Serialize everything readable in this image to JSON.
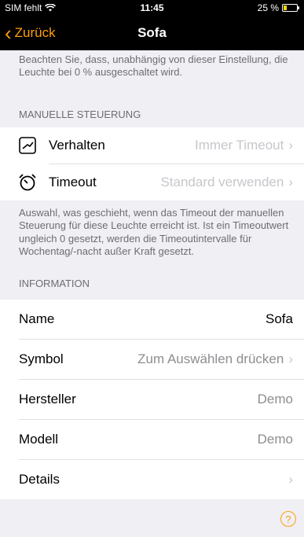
{
  "status": {
    "carrier": "SIM fehlt",
    "time": "11:45",
    "battery": "25 %",
    "battery_level": 0.25
  },
  "nav": {
    "back_label": "Zurück",
    "title": "Sofa"
  },
  "top_note": "Beachten Sie, dass, unabhängig von dieser Einstellung, die Leuchte bei 0 % ausgeschaltet wird.",
  "manual": {
    "header": "MANUELLE STEUERUNG",
    "rows": [
      {
        "label": "Verhalten",
        "value": "Immer Timeout",
        "icon": "behavior-icon"
      },
      {
        "label": "Timeout",
        "value": "Standard verwenden",
        "icon": "timer-icon"
      }
    ],
    "footer": "Auswahl, was geschieht, wenn das Timeout der manuellen Steuerung für diese Leuchte erreicht ist. Ist ein Timeoutwert ungleich 0 gesetzt, werden die Timeoutintervalle für Wochentag/-nacht außer Kraft gesetzt."
  },
  "info": {
    "header": "INFORMATION",
    "rows": [
      {
        "label": "Name",
        "value": "Sofa"
      },
      {
        "label": "Symbol",
        "value": "Zum Auswählen drücken"
      },
      {
        "label": "Hersteller",
        "value": "Demo"
      },
      {
        "label": "Modell",
        "value": "Demo"
      },
      {
        "label": "Details",
        "value": ""
      }
    ]
  },
  "help_symbol": "?",
  "colors": {
    "accent": "#ff9f0a",
    "background": "#efeff4"
  }
}
